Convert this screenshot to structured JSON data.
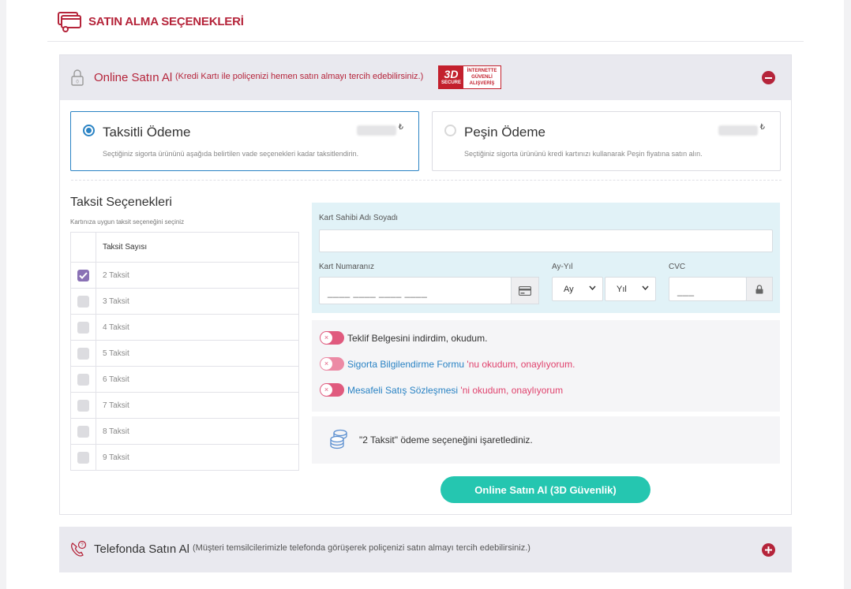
{
  "header": {
    "title": "SATIN ALMA SEÇENEKLERİ"
  },
  "online": {
    "title": "Online Satın Al",
    "subtitle": "(Kredi Kartı ile poliçenizi hemen satın almayı tercih edebilirsiniz.)",
    "badge": {
      "big": "3D",
      "small": "SECURE",
      "line1": "İNTERNETTE",
      "line2": "GÜVENLİ",
      "line3": "ALIŞVERİŞ"
    },
    "payment_options": [
      {
        "title": "Taksitli Ödeme",
        "desc": "Seçtiğiniz sigorta ürününü aşağıda belirtilen vade seçenekleri kadar taksitlendirin.",
        "currency": "₺",
        "selected": true
      },
      {
        "title": "Peşin Ödeme",
        "desc": "Seçtiğiniz sigorta ürününü kredi kartınızı kullanarak Peşin fiyatına satın alın.",
        "currency": "₺",
        "selected": false
      }
    ],
    "installments": {
      "title": "Taksit Seçenekleri",
      "subtitle": "Kartınıza uygun taksit seçeneğini seçiniz",
      "column_header": "Taksit Sayısı",
      "rows": [
        {
          "label": "2 Taksit",
          "checked": true
        },
        {
          "label": "3 Taksit",
          "checked": false
        },
        {
          "label": "4 Taksit",
          "checked": false
        },
        {
          "label": "5 Taksit",
          "checked": false
        },
        {
          "label": "6 Taksit",
          "checked": false
        },
        {
          "label": "7 Taksit",
          "checked": false
        },
        {
          "label": "8 Taksit",
          "checked": false
        },
        {
          "label": "9 Taksit",
          "checked": false
        }
      ]
    },
    "card": {
      "holder_label": "Kart Sahibi Adı Soyadı",
      "holder_value": "",
      "number_label": "Kart Numaranız",
      "number_placeholder": "____ ____ ____ ____",
      "expiry_label": "Ay-Yıl",
      "month": "Ay",
      "year": "Yıl",
      "cvc_label": "CVC",
      "cvc_placeholder": "___"
    },
    "agreements": {
      "a1": {
        "text": "Teklif Belgesini indirdim, okudum."
      },
      "a2": {
        "link": "Sigorta Bilgilendirme Formu",
        "rest": " 'nu okudum, onaylıyorum."
      },
      "a3": {
        "link": "Mesafeli Satış Sözleşmesi",
        "rest": " 'ni okudum, onaylıyorum"
      }
    },
    "info_text": "\"2 Taksit\" ödeme seçeneğini işaretlediniz.",
    "buy_button": "Online Satın Al (3D Güvenlik)"
  },
  "phone": {
    "title": "Telefonda Satın Al",
    "subtitle": "(Müşteri temsilcilerimizle telefonda görüşerek poliçenizi satın almayı tercih edebilirsiniz.)"
  },
  "colors": {
    "brand": "#b5243a",
    "accent_blue": "#2a83c4",
    "teal": "#25c6b0",
    "pink": "#e0426d"
  }
}
